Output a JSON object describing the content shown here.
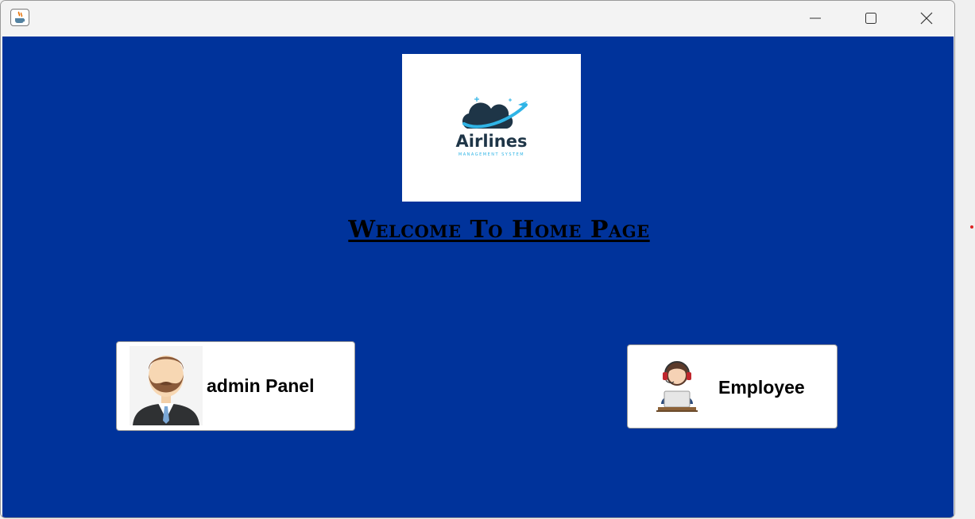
{
  "window": {
    "title": "",
    "app_icon": "java-coffee-icon",
    "controls": [
      "minimize-icon",
      "maximize-icon",
      "close-icon"
    ]
  },
  "logo": {
    "word": "Airlines",
    "subtitle": "MANAGEMENT SYSTEM",
    "icon": "cloud-airplane-icon"
  },
  "heading": "Welcome To Home Page",
  "buttons": {
    "admin": {
      "label": "admin Panel",
      "icon": "businessman-avatar-icon"
    },
    "employee": {
      "label": "Employee",
      "icon": "call-center-agent-icon"
    }
  },
  "colors": {
    "background": "#00339b",
    "title_bar": "#f3f3f3",
    "logo_dark": "#1e3547",
    "logo_accent": "#2fb4e6"
  }
}
